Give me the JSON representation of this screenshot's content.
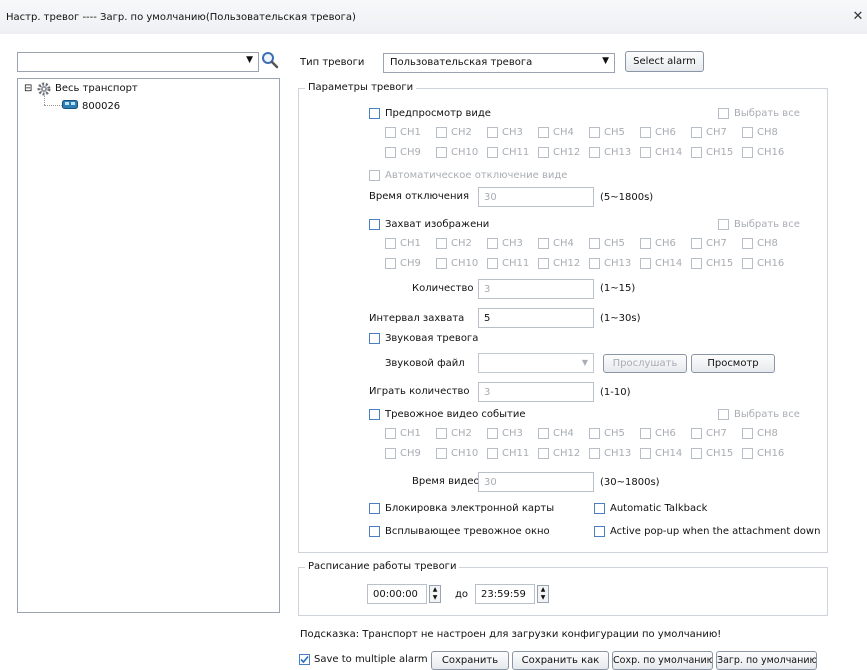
{
  "window": {
    "title": "Настр. тревог ---- Загр. по умолчанию(Пользовательская тревога)",
    "close_glyph": "✕"
  },
  "left_panel": {
    "search_value": "",
    "tree": {
      "root_label": "Весь транспорт",
      "root_expander": "⊟",
      "child_label": "800026"
    }
  },
  "alarm_type": {
    "label": "Тип тревоги",
    "selected": "Пользовательская тревога",
    "select_button": "Select alarm"
  },
  "params": {
    "legend": "Параметры тревоги",
    "select_all": "Выбрать все",
    "channels": [
      "CH1",
      "CH2",
      "CH3",
      "CH4",
      "CH5",
      "CH6",
      "CH7",
      "CH8",
      "CH9",
      "CH10",
      "CH11",
      "CH12",
      "CH13",
      "CH14",
      "CH15",
      "CH16"
    ],
    "video_preview": {
      "label": "Предпросмотр виде",
      "auto_off_label": "Автоматическое отключение виде",
      "off_time_label": "Время отключения",
      "off_time_value": "30",
      "off_time_range": "(5~1800s)"
    },
    "capture": {
      "label": "Захват изображени",
      "count_label": "Количество",
      "count_value": "3",
      "count_range": "(1~15)",
      "interval_label": "Интервал захвата",
      "interval_value": "5",
      "interval_range": "(1~30s)"
    },
    "sound": {
      "label": "Звуковая тревога",
      "file_label": "Звуковой файл",
      "file_value": "",
      "listen_button": "Прослушать",
      "browse_button": "Просмотр",
      "play_count_label": "Играть количество",
      "play_count_value": "3",
      "play_count_range": "(1-10)"
    },
    "alarm_video": {
      "label": "Тревожное видео событие",
      "time_label": "Время видео",
      "time_value": "30",
      "time_range": "(30~1800s)"
    },
    "map_lock_label": "Блокировка электронной карты",
    "popup_label": "Всплывающее тревожное окно",
    "talkback_label": "Automatic Talkback",
    "active_popup_label": "Active pop-up when the attachment down"
  },
  "schedule": {
    "legend": "Расписание работы тревоги",
    "start": "00:00:00",
    "to_label": "до",
    "end": "23:59:59"
  },
  "hint": "Подсказка: Транспорт не настроен для загрузки конфигурации по умолчанию!",
  "footer": {
    "save_multiple_label": "Save to multiple alarm",
    "save_multiple_checked": true,
    "save_button": "Сохранить",
    "save_as_button": "Сохранить как",
    "save_default_button": "Сохр. по умолчанию",
    "load_default_button": "Загр. по умолчанию"
  },
  "icons": {
    "search": "search-icon",
    "dropdown": "chevron-down-icon",
    "gear": "gear-icon",
    "vehicle": "vehicle-icon"
  },
  "colors": {
    "accent": "#4a7fc1",
    "disabled_text": "#a8adb3",
    "border": "#9aa4b1"
  }
}
